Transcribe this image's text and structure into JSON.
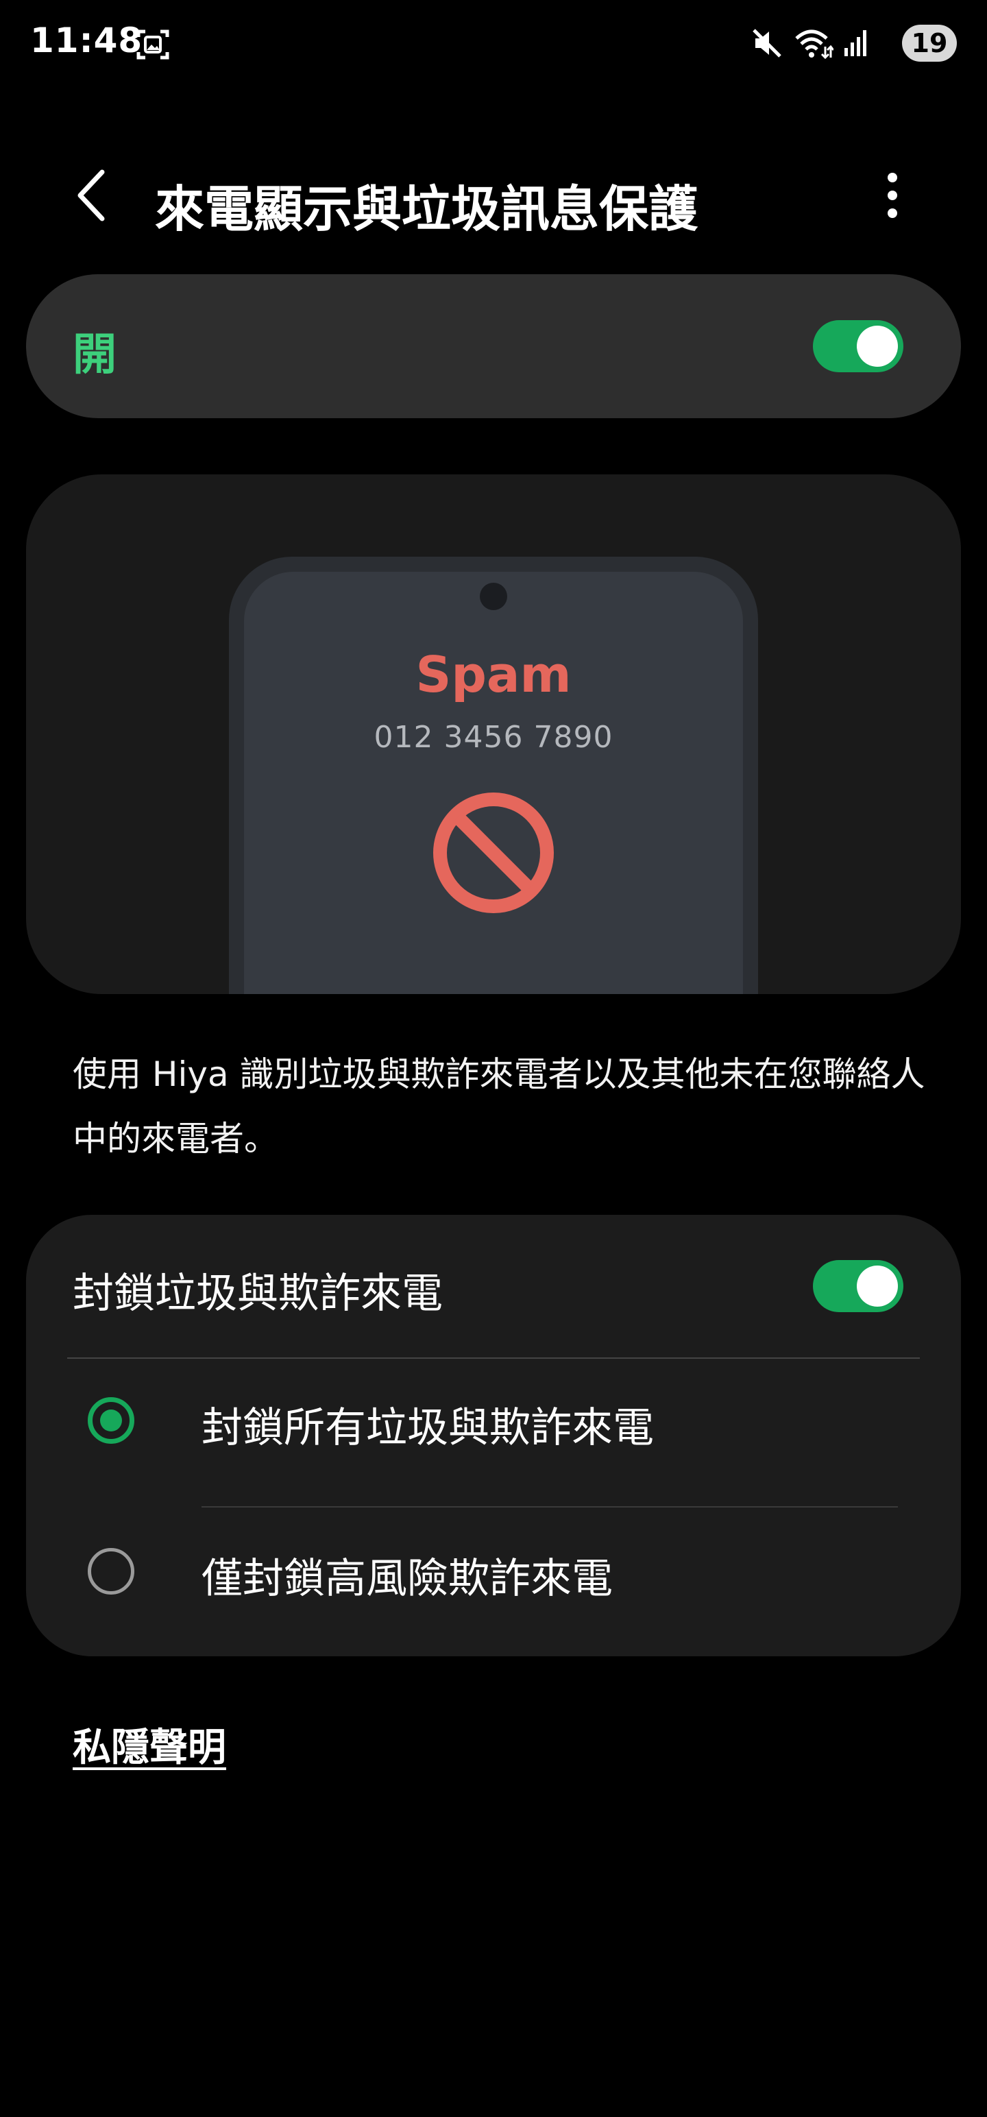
{
  "status_bar": {
    "time": "11:48",
    "battery": "19",
    "icons": [
      "screenshot-icon",
      "mute-icon",
      "wifi-icon",
      "signal-icon",
      "battery-icon"
    ]
  },
  "header": {
    "title": "來電顯示與垃圾訊息保護",
    "back_icon": "back-arrow-icon",
    "more_icon": "more-vert-icon"
  },
  "master_toggle": {
    "label": "開",
    "state": "on",
    "label_color": "#3dd07c"
  },
  "illustration": {
    "spam_label": "Spam",
    "phone_number": "012 3456 7890",
    "icon": "block-icon",
    "spam_color": "#e5675c"
  },
  "description": "使用 Hiya 識別垃圾與欺詐來電者以及其他未在您聯絡人中的來電者。",
  "block_settings": {
    "label": "封鎖垃圾與欺詐來電",
    "state": "on",
    "options": [
      {
        "label": "封鎖所有垃圾與欺詐來電",
        "selected": true
      },
      {
        "label": "僅封鎖高風險欺詐來電",
        "selected": false
      }
    ]
  },
  "privacy_link": "私隱聲明",
  "colors": {
    "accent": "#16a85a",
    "background": "#000000",
    "card": "#1c1c1c"
  }
}
